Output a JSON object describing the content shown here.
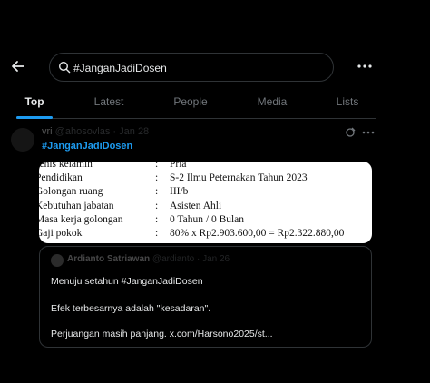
{
  "search": {
    "value": "#JanganJadiDosen"
  },
  "tabs": [
    {
      "label": "Top",
      "active": true
    },
    {
      "label": "Latest"
    },
    {
      "label": "People"
    },
    {
      "label": "Media"
    },
    {
      "label": "Lists"
    }
  ],
  "post": {
    "display_name": "vri",
    "handle": "@ahosovlas · Jan 28",
    "hashtag": "#JanganJadiDosen",
    "image_rows": [
      {
        "key": "Jenis kelamin",
        "colon": ":",
        "value": "Pria"
      },
      {
        "key": "Pendidikan",
        "colon": ":",
        "value": "S-2 Ilmu Peternakan Tahun 2023"
      },
      {
        "key": "Golongan ruang",
        "colon": ":",
        "value": "III/b"
      },
      {
        "key": "Kebutuhan jabatan",
        "colon": ":",
        "value": "Asisten Ahli"
      },
      {
        "key": "Masa kerja golongan",
        "colon": ":",
        "value": "0 Tahun / 0 Bulan"
      },
      {
        "key": "Gaji pokok",
        "colon": ":",
        "value": "80% x Rp2.903.600,00 = Rp2.322.880,00"
      }
    ],
    "quote": {
      "name": "Ardianto Satriawan",
      "handle": "@ardianto · Jan 26",
      "line1": "Menuju setahun #JanganJadiDosen",
      "line2": "Efek terbesarnya adalah \"kesadaran\".",
      "line3": "Perjuangan masih panjang. x.com/Harsono2025/st..."
    }
  },
  "colors": {
    "accent": "#1d9bf0",
    "background": "#000000",
    "border": "#2f3336",
    "muted": "#71767b"
  }
}
